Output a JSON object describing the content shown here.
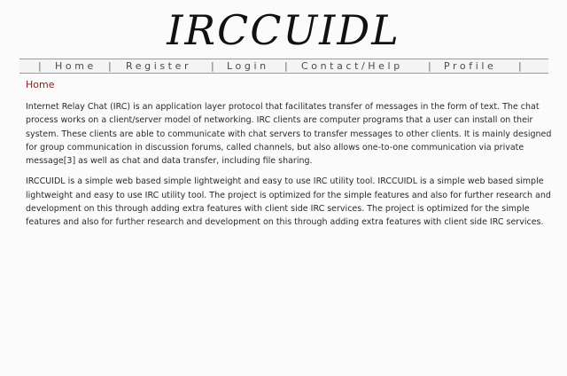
{
  "site": {
    "logo_text": "IRCCUIDL"
  },
  "nav": {
    "items": [
      {
        "label": "Home"
      },
      {
        "label": "Register"
      },
      {
        "label": "Login"
      },
      {
        "label": "Contact/Help"
      },
      {
        "label": "Profile"
      }
    ],
    "separator": "|"
  },
  "breadcrumb": {
    "label": "Home"
  },
  "main": {
    "paragraphs": [
      "Internet Relay Chat (IRC) is an application layer protocol that facilitates transfer of messages in the form of text. The chat process works on a client/server model of networking. IRC clients are computer programs that a user can install on their system. These clients are able to communicate with chat servers to transfer messages to other clients. It is mainly designed for group communication in discussion forums, called channels, but also allows one-to-one communication via private message[3] as well as chat and data transfer, including file sharing.",
      "IRCCUIDL is a simple web based simple lightweight and easy to use IRC utility tool. IRCCUIDL is a simple web based simple lightweight and easy to use IRC utility tool. The project is optimized for the simple features and also for further research and development on this through adding extra features with client side IRC services. The project is optimized for the simple features and also for further research and development on this through adding extra features with client side IRC services."
    ]
  }
}
